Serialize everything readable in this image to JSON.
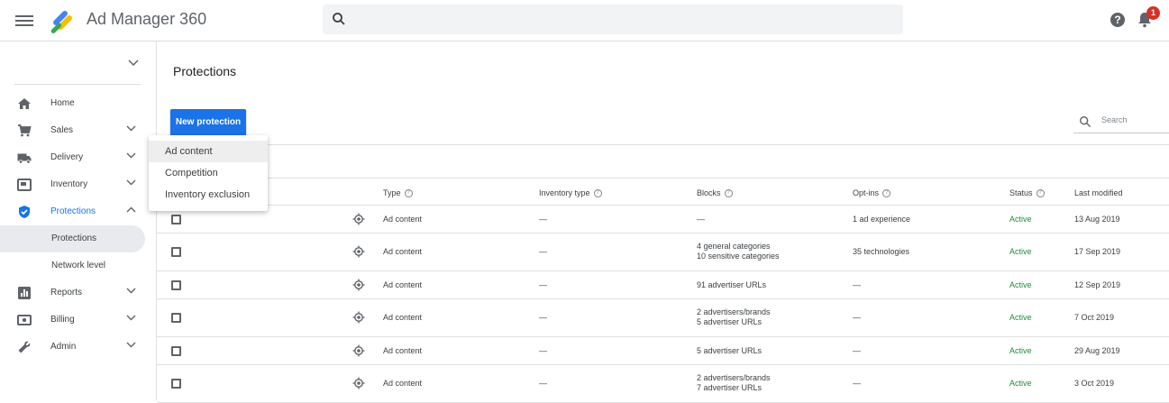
{
  "app": {
    "title": "Ad Manager 360",
    "notification_count": "1"
  },
  "search": {
    "placeholder": ""
  },
  "sidebar": {
    "items": [
      {
        "label": "Home",
        "icon": "home-icon",
        "chevron": false
      },
      {
        "label": "Sales",
        "icon": "cart-icon",
        "chevron": true
      },
      {
        "label": "Delivery",
        "icon": "truck-icon",
        "chevron": true
      },
      {
        "label": "Inventory",
        "icon": "inventory-icon",
        "chevron": true
      },
      {
        "label": "Protections",
        "icon": "shield-icon",
        "chevron": true,
        "active": true
      }
    ],
    "sub_items": [
      {
        "label": "Protections",
        "selected": true
      },
      {
        "label": "Network level",
        "selected": false
      }
    ],
    "items_after": [
      {
        "label": "Reports",
        "icon": "reports-icon"
      },
      {
        "label": "Billing",
        "icon": "billing-icon"
      },
      {
        "label": "Admin",
        "icon": "wrench-icon"
      }
    ]
  },
  "main": {
    "title": "Protections",
    "new_button": "New protection",
    "table_search_placeholder": "Search",
    "dropdown": [
      "Ad content",
      "Competition",
      "Inventory exclusion"
    ],
    "columns": [
      {
        "label": "Type",
        "help": true
      },
      {
        "label": "Inventory type",
        "help": true
      },
      {
        "label": "Blocks",
        "help": true
      },
      {
        "label": "Opt-ins",
        "help": true
      },
      {
        "label": "Status",
        "help": true
      },
      {
        "label": "Last modified",
        "help": false
      }
    ],
    "rows": [
      {
        "type": "Ad content",
        "inventory": "—",
        "blocks": [
          "—"
        ],
        "optins": "1 ad experience",
        "status": "Active",
        "modified": "13 Aug 2019"
      },
      {
        "type": "Ad content",
        "inventory": "—",
        "blocks": [
          "4 general categories",
          "10 sensitive categories"
        ],
        "optins": "35 technologies",
        "status": "Active",
        "modified": "17 Sep 2019"
      },
      {
        "type": "Ad content",
        "inventory": "—",
        "blocks": [
          "91 advertiser URLs"
        ],
        "optins": "—",
        "status": "Active",
        "modified": "12 Sep 2019"
      },
      {
        "type": "Ad content",
        "inventory": "—",
        "blocks": [
          "2 advertisers/brands",
          "5 advertiser URLs"
        ],
        "optins": "—",
        "status": "Active",
        "modified": "7 Oct 2019"
      },
      {
        "type": "Ad content",
        "inventory": "—",
        "blocks": [
          "5 advertiser URLs"
        ],
        "optins": "—",
        "status": "Active",
        "modified": "29 Aug 2019"
      },
      {
        "type": "Ad content",
        "inventory": "—",
        "blocks": [
          "2 advertisers/brands",
          "7 advertiser URLs"
        ],
        "optins": "—",
        "status": "Active",
        "modified": "3 Oct 2019"
      }
    ]
  },
  "colors": {
    "accent": "#1a73e8",
    "active": "#1e8e3e",
    "badge": "#d93025"
  }
}
